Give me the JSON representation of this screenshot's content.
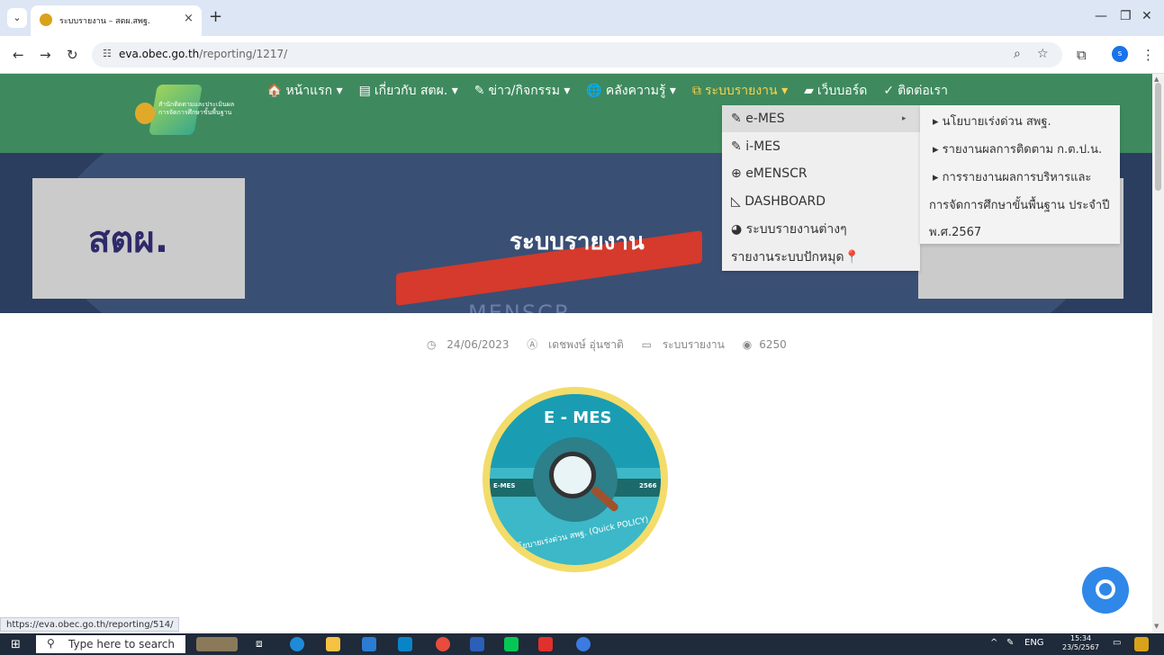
{
  "browser": {
    "tab_title": "ระบบรายงาน – สตผ.สพฐ.",
    "tab_close": "×",
    "new_tab": "+",
    "url_host": "eva.obec.go.th",
    "url_path": "/reporting/1217/",
    "status_url": "https://eva.obec.go.th/reporting/514/",
    "profile_initial": "s"
  },
  "site": {
    "logo_line1": "สำนักติดตามและประเมินผล",
    "logo_line2": "การจัดการศึกษาขั้นพื้นฐาน",
    "menu": [
      {
        "icon": "🏠",
        "label": "หน้าแรก ▾"
      },
      {
        "icon": "▤",
        "label": "เกี่ยวกับ สตผ. ▾"
      },
      {
        "icon": "✎",
        "label": "ข่าว/กิจกรรม ▾"
      },
      {
        "icon": "🌐",
        "label": "คลังความรู้ ▾"
      },
      {
        "icon": "⧉",
        "label": "ระบบรายงาน ▾"
      },
      {
        "icon": "▰",
        "label": "เว็บบอร์ด"
      },
      {
        "icon": "✓",
        "label": "ติดต่อเรา"
      }
    ]
  },
  "hero": {
    "left_text": "สตผ.",
    "title": "ระบบรายงาน",
    "bottom_text": "MENSCR"
  },
  "post_meta": {
    "date": "24/06/2023",
    "author": "เดชพงษ์ อุ่นชาติ",
    "category": "ระบบรายงาน",
    "views": "6250"
  },
  "badge": {
    "title": "E - MES",
    "left": "E-MES",
    "right": "2566",
    "bottom": "นโยบายเร่งด่วน สพฐ. (Quick POLICY)"
  },
  "dropdown_primary": [
    {
      "icon": "✎",
      "label": "e-MES",
      "arrow": "▸"
    },
    {
      "icon": "✎",
      "label": "i-MES"
    },
    {
      "icon": "⊕",
      "label": "eMENSCR"
    },
    {
      "icon": "◺",
      "label": "DASHBOARD"
    },
    {
      "icon": "◕",
      "label": "ระบบรายงานต่างๆ"
    },
    {
      "icon": "",
      "label": "รายงานระบบปักหมุด📍"
    }
  ],
  "dropdown_secondary": [
    "▸ นโยบายเร่งด่วน สพฐ.",
    "▸ รายงานผลการติดตาม ก.ต.ป.น.",
    "▸ การรายงานผลการบริหารและ",
    "การจัดการศึกษาขั้นพื้นฐาน ประจำปี",
    "พ.ศ.2567"
  ],
  "taskbar": {
    "search_placeholder": "Type here to search",
    "lang": "ENG",
    "time": "15:34",
    "date": "23/5/2567"
  }
}
